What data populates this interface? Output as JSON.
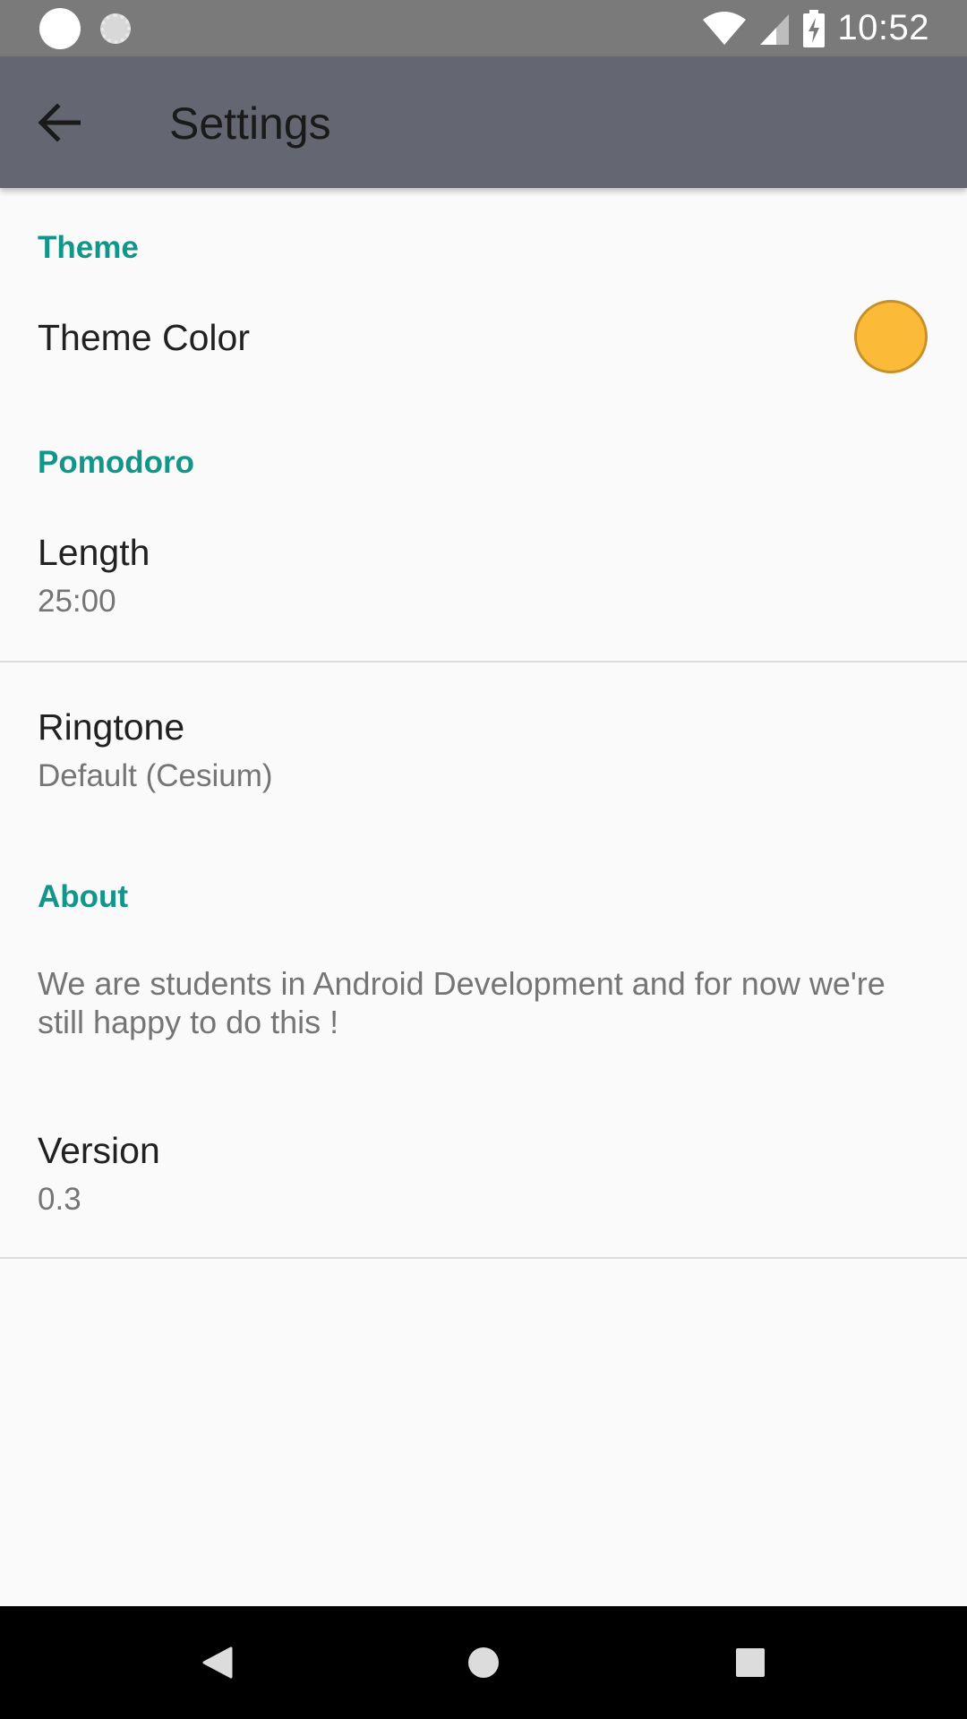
{
  "status_bar": {
    "time": "10:52",
    "icons": [
      "notification-dot-icon",
      "sync-spinner-icon",
      "wifi-icon",
      "cell-signal-icon",
      "battery-charging-icon"
    ]
  },
  "app_bar": {
    "title": "Settings",
    "back_icon": "arrow-back-icon"
  },
  "sections": {
    "theme": {
      "header": "Theme",
      "theme_color": {
        "title": "Theme Color",
        "swatch_color": "#fbba37"
      }
    },
    "pomodoro": {
      "header": "Pomodoro",
      "length": {
        "title": "Length",
        "summary": "25:00"
      },
      "ringtone": {
        "title": "Ringtone",
        "summary": "Default (Cesium)"
      }
    },
    "about": {
      "header": "About",
      "description": "We are students in Android Development and for now we're still happy to do this !",
      "version": {
        "title": "Version",
        "summary": "0.3"
      }
    }
  },
  "colors": {
    "accent": "#12968a",
    "app_bar": "#646672",
    "status_bar": "#7a7a7a"
  },
  "nav_bar": {
    "icons": [
      "nav-back-icon",
      "nav-home-icon",
      "nav-recents-icon"
    ]
  }
}
